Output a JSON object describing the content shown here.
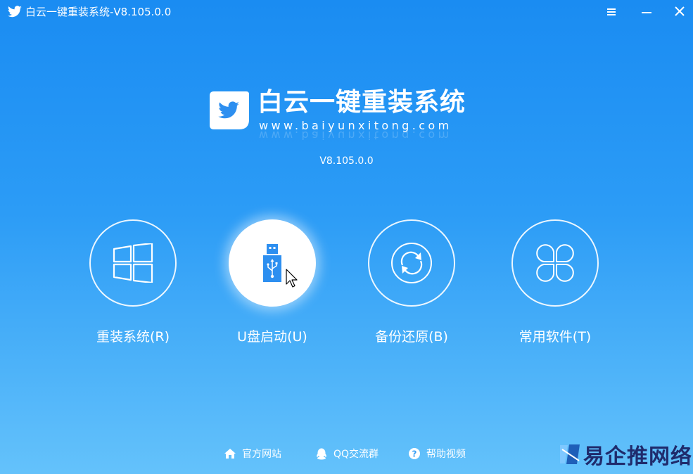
{
  "window": {
    "title": "白云一键重装系统-V8.105.0.0",
    "icons": {
      "app": "bird-icon",
      "menu": "menu-icon",
      "minimize": "minimize-icon",
      "close": "close-icon"
    }
  },
  "brand": {
    "name": "白云一键重装系统",
    "url": "www.baiyunxitong.com",
    "version": "V8.105.0.0"
  },
  "features": [
    {
      "label": "重装系统(R)",
      "icon": "windows-icon",
      "active": false
    },
    {
      "label": "U盘启动(U)",
      "icon": "usb-icon",
      "active": true
    },
    {
      "label": "备份还原(B)",
      "icon": "refresh-icon",
      "active": false
    },
    {
      "label": "常用软件(T)",
      "icon": "apps-icon",
      "active": false
    }
  ],
  "footer": {
    "links": [
      {
        "label": "官方网站",
        "icon": "home-icon"
      },
      {
        "label": "QQ交流群",
        "icon": "qq-icon"
      },
      {
        "label": "帮助视频",
        "icon": "help-icon"
      }
    ]
  },
  "watermark": {
    "text": "易企推网络"
  },
  "colors": {
    "background_top": "#1a8cf2",
    "background_bottom": "#64c2fb",
    "accent": "#2d8ff0",
    "text": "#ffffff"
  }
}
